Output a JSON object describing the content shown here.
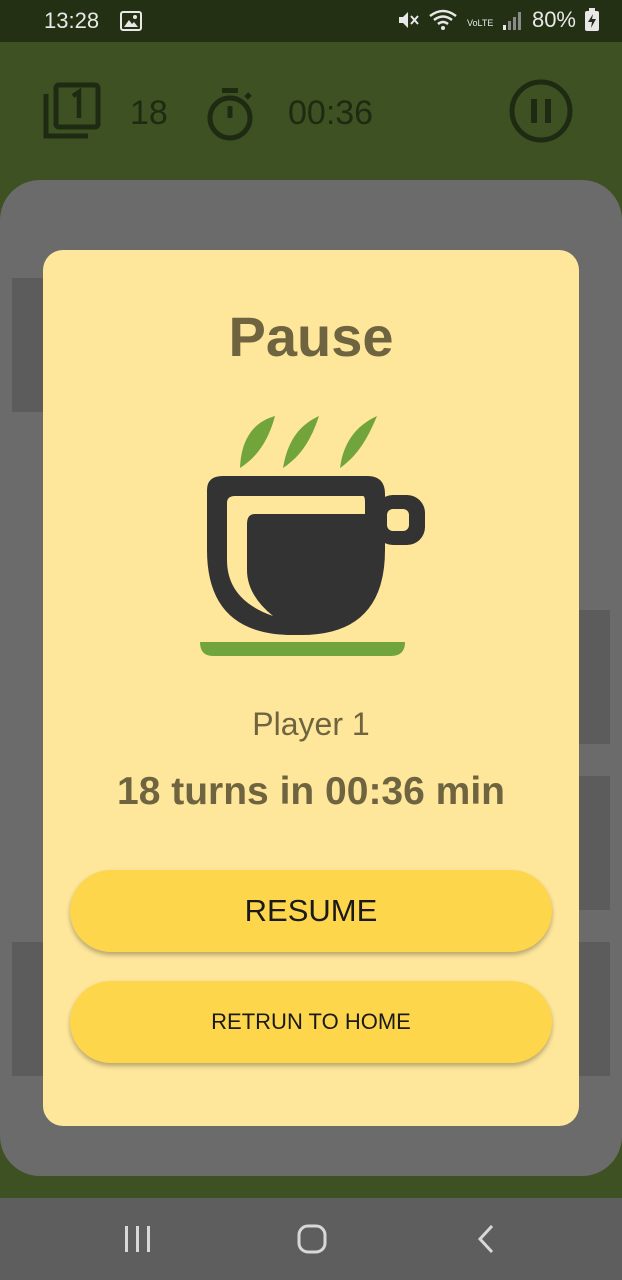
{
  "status_bar": {
    "time": "13:28",
    "battery_percent": "80%",
    "network_label": "VoLTE1"
  },
  "header": {
    "turns": "18",
    "time": "00:36"
  },
  "dialog": {
    "title": "Pause",
    "player": "Player 1",
    "summary": "18 turns in 00:36 min",
    "resume_label": "RESUME",
    "home_label": "RETRUN TO HOME"
  },
  "icons": {
    "cards": "cards-icon",
    "timer": "stopwatch-icon",
    "pause": "pause-icon",
    "coffee": "coffee-cup-icon",
    "nav_recents": "recents-icon",
    "nav_home": "home-icon",
    "nav_back": "back-icon"
  },
  "colors": {
    "app_bar": "#3d5122",
    "status_bar": "#243014",
    "dialog_bg": "#fee69b",
    "button": "#fed64b",
    "text_brown": "#6f6440",
    "leaf_green": "#72a43c",
    "cup_dark": "#333333",
    "board_gray": "#6b6b6b"
  }
}
